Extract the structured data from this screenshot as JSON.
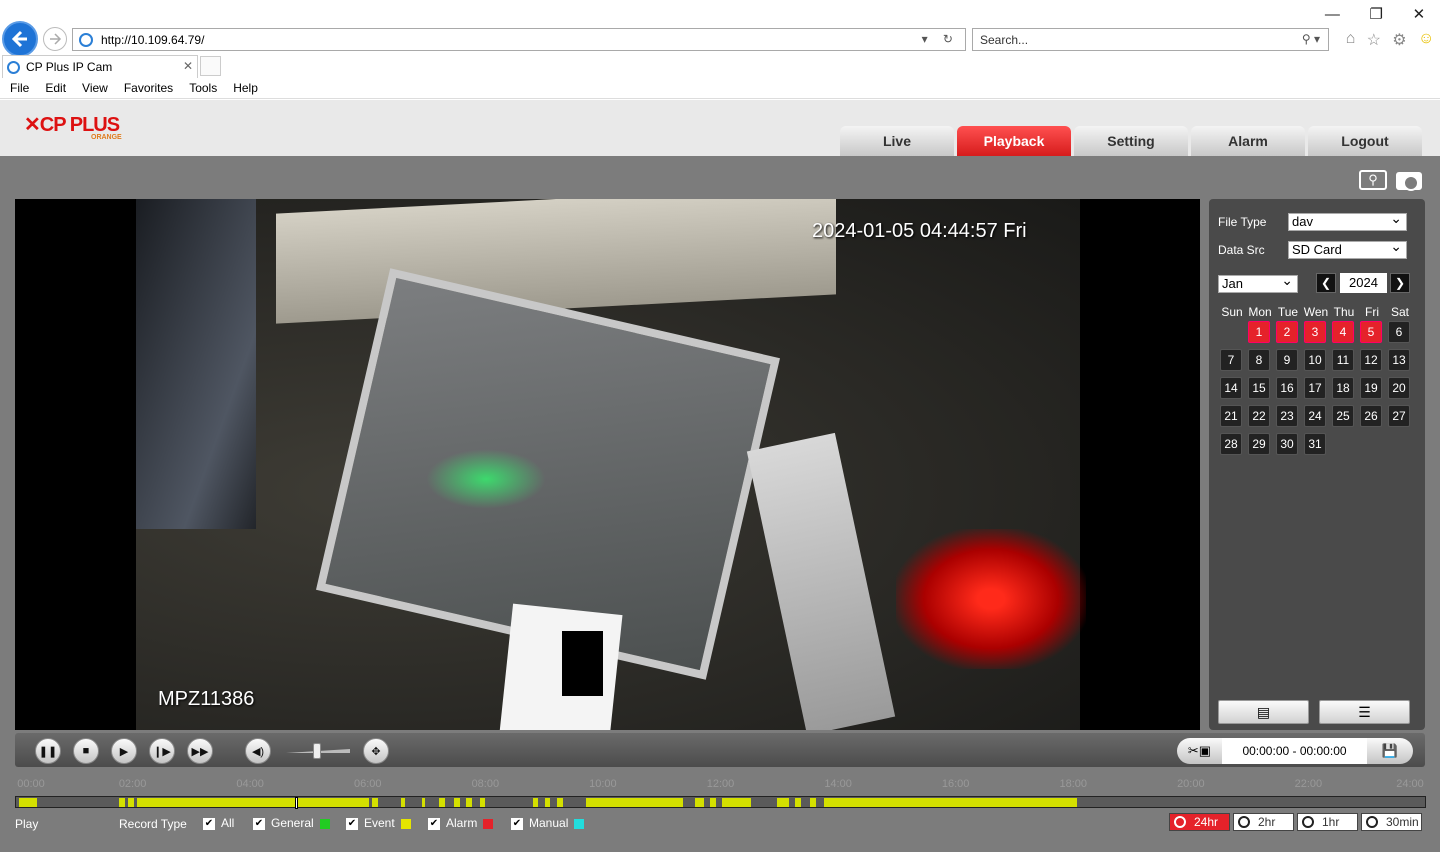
{
  "browser": {
    "url": "http://10.109.64.79/",
    "search_placeholder": "Search...",
    "tab_title": "CP Plus IP Cam",
    "menu": [
      "File",
      "Edit",
      "View",
      "Favorites",
      "Tools",
      "Help"
    ]
  },
  "brand": {
    "logo": "CP PLUS",
    "sub": "ORANGE",
    "color": "#d11f1f"
  },
  "nav": {
    "tabs": [
      {
        "label": "Live",
        "active": false
      },
      {
        "label": "Playback",
        "active": true
      },
      {
        "label": "Setting",
        "active": false
      },
      {
        "label": "Alarm",
        "active": false
      },
      {
        "label": "Logout",
        "active": false
      }
    ]
  },
  "video": {
    "osd_time": "2024-01-05 04:44:57 Fri",
    "osd_channel": "MPZ11386"
  },
  "panel": {
    "file_type_label": "File Type",
    "file_type_value": "dav",
    "data_src_label": "Data Src",
    "data_src_value": "SD Card",
    "month": "Jan",
    "year": "2024",
    "weekdays": [
      "Sun",
      "Mon",
      "Tue",
      "Wen",
      "Thu",
      "Fri",
      "Sat"
    ],
    "first_day_offset": 1,
    "days_in_month": 31,
    "record_days": [
      1,
      2,
      3,
      4,
      5
    ]
  },
  "controls": {
    "time_range": "00:00:00 - 00:00:00"
  },
  "timeline": {
    "ticks": [
      "00:00",
      "02:00",
      "04:00",
      "06:00",
      "08:00",
      "10:00",
      "12:00",
      "14:00",
      "16:00",
      "18:00",
      "20:00",
      "22:00",
      "24:00"
    ],
    "cursor_hour": 4.75,
    "segments_hours": [
      [
        0.05,
        0.35
      ],
      [
        1.75,
        1.85
      ],
      [
        1.9,
        2.0
      ],
      [
        2.05,
        6.0
      ],
      [
        6.05,
        6.15
      ],
      [
        6.55,
        6.62
      ],
      [
        6.9,
        6.95
      ],
      [
        7.2,
        7.3
      ],
      [
        7.45,
        7.55
      ],
      [
        7.65,
        7.75
      ],
      [
        7.9,
        7.98
      ],
      [
        8.8,
        8.88
      ],
      [
        9.0,
        9.08
      ],
      [
        9.2,
        9.3
      ],
      [
        9.7,
        11.35
      ],
      [
        11.55,
        11.7
      ],
      [
        11.8,
        11.9
      ],
      [
        12.0,
        12.5
      ],
      [
        12.95,
        13.15
      ],
      [
        13.25,
        13.35
      ],
      [
        13.5,
        13.6
      ],
      [
        13.75,
        18.05
      ]
    ]
  },
  "bottom": {
    "play_label": "Play",
    "record_type_label": "Record Type",
    "filters": [
      {
        "label": "All",
        "color": ""
      },
      {
        "label": "General",
        "color": "#22cc22"
      },
      {
        "label": "Event",
        "color": "#e5e500"
      },
      {
        "label": "Alarm",
        "color": "#e5222a"
      },
      {
        "label": "Manual",
        "color": "#22dddd"
      }
    ],
    "zoom": [
      {
        "label": "24hr",
        "active": true
      },
      {
        "label": "2hr",
        "active": false
      },
      {
        "label": "1hr",
        "active": false
      },
      {
        "label": "30min",
        "active": false
      }
    ]
  }
}
